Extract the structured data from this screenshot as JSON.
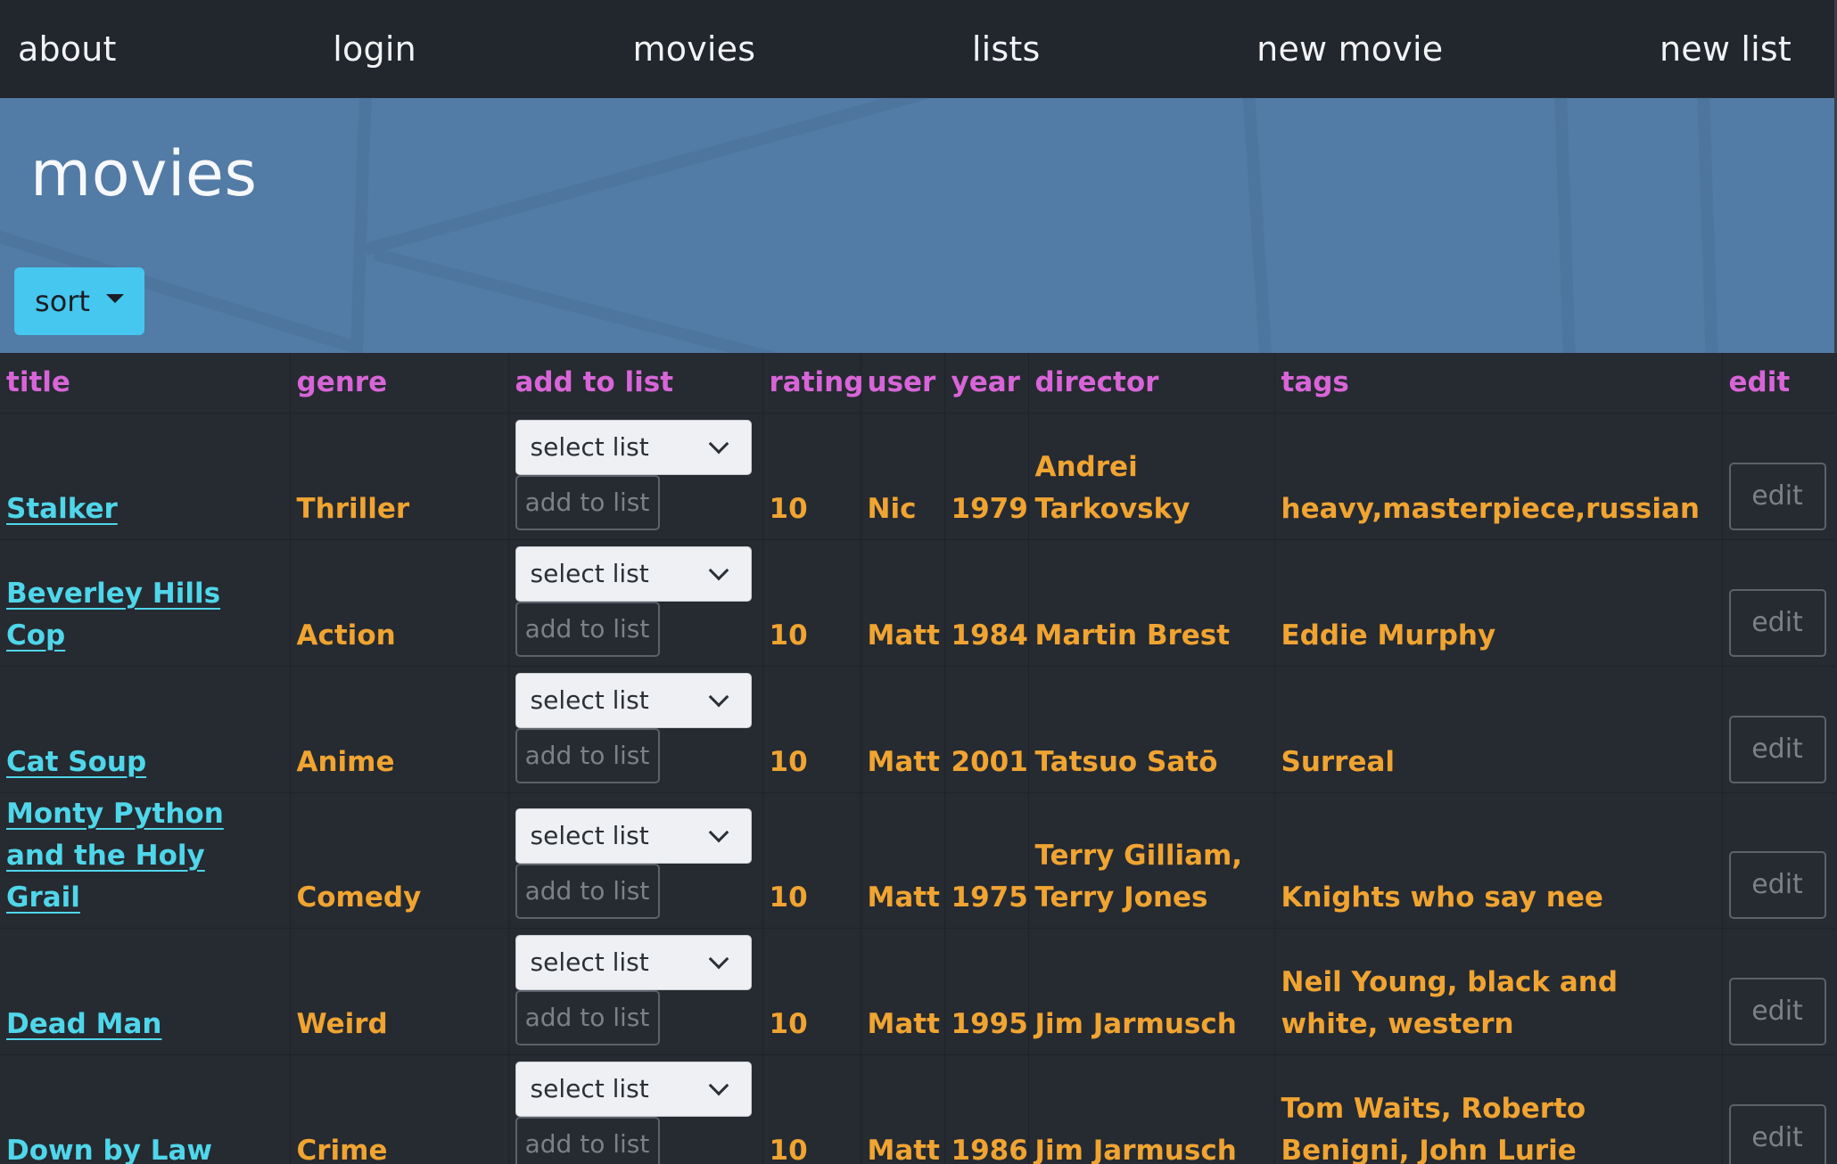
{
  "nav": {
    "about": "about",
    "login": "login",
    "movies": "movies",
    "lists": "lists",
    "new_movie": "new movie",
    "new_list": "new list"
  },
  "banner": {
    "title": "movies",
    "sort_label": "sort"
  },
  "table": {
    "headers": [
      "title",
      "genre",
      "add to list",
      "rating",
      "user",
      "year",
      "director",
      "tags",
      "edit"
    ],
    "select_placeholder": "select list",
    "add_label": "add to list",
    "edit_label": "edit",
    "rows": [
      {
        "title": "Stalker",
        "genre": "Thriller",
        "rating": "10",
        "user": "Nic",
        "year": "1979",
        "director": "Andrei Tarkovsky",
        "tags": "heavy,masterpiece,russian"
      },
      {
        "title": "Beverley Hills Cop",
        "genre": "Action",
        "rating": "10",
        "user": "Matt",
        "year": "1984",
        "director": "Martin Brest",
        "tags": "Eddie Murphy"
      },
      {
        "title": "Cat Soup",
        "genre": "Anime",
        "rating": "10",
        "user": "Matt",
        "year": "2001",
        "director": "Tatsuo Satō",
        "tags": "Surreal"
      },
      {
        "title": "Monty Python and the Holy Grail",
        "genre": "Comedy",
        "rating": "10",
        "user": "Matt",
        "year": "1975",
        "director": "Terry Gilliam, Terry Jones",
        "tags": "Knights who say nee"
      },
      {
        "title": "Dead Man",
        "genre": "Weird",
        "rating": "10",
        "user": "Matt",
        "year": "1995",
        "director": "Jim Jarmusch",
        "tags": "Neil Young, black and white, western"
      },
      {
        "title": "Down by Law",
        "genre": "Crime",
        "rating": "10",
        "user": "Matt",
        "year": "1986",
        "director": "Jim Jarmusch",
        "tags": "Tom Waits, Roberto Benigni, John Lurie"
      }
    ]
  },
  "colors": {
    "navbar_bg": "#22262d",
    "banner_bg": "#527ba5",
    "header_text": "#d865d8",
    "cell_text": "#f0a431",
    "link": "#4fd6ea",
    "sort_button": "#45c7ef"
  }
}
